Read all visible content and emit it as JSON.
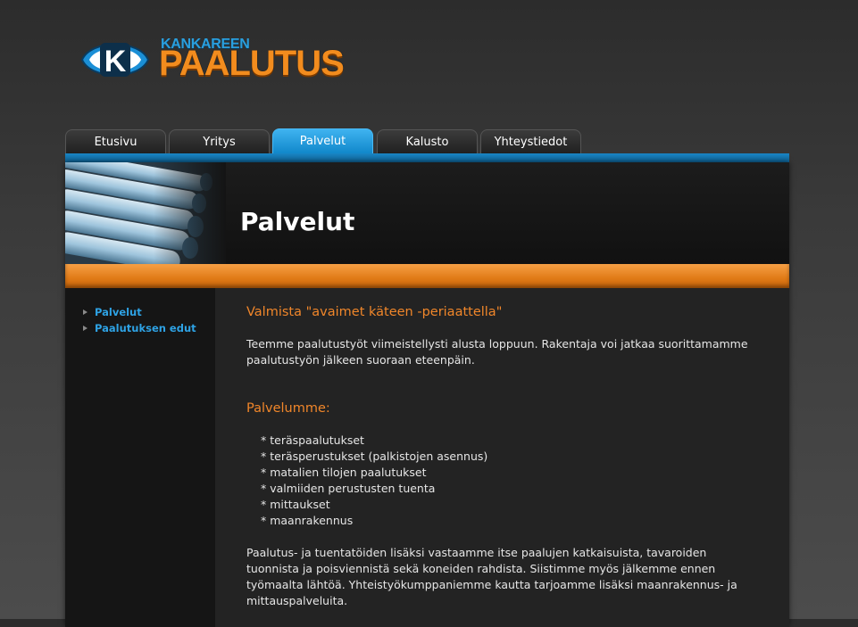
{
  "brand": {
    "badge_letter": "K",
    "name_top": "KANKAREEN",
    "name_main": "PAALUTUS",
    "colors": {
      "blue": "#2a9fde",
      "orange": "#f28c1e"
    }
  },
  "nav": {
    "tabs": [
      {
        "label": "Etusivu",
        "active": false
      },
      {
        "label": "Yritys",
        "active": false
      },
      {
        "label": "Palvelut",
        "active": true
      },
      {
        "label": "Kalusto",
        "active": false
      },
      {
        "label": "Yhteystiedot",
        "active": false
      }
    ]
  },
  "banner": {
    "title": "Palvelut"
  },
  "sidebar": {
    "items": [
      {
        "label": "Palvelut",
        "icon": "arrow-right-icon"
      },
      {
        "label": "Paalutuksen edut",
        "icon": "arrow-right-icon"
      }
    ]
  },
  "content": {
    "heading": "Valmista \"avaimet käteen -periaattella\"",
    "intro": "Teemme paalutustyöt viimeistellysti alusta loppuun. Rakentaja voi jatkaa suorittamamme paalutustyön jälkeen suoraan eteenpäin.",
    "services_heading": "Palvelumme:",
    "services": [
      "* teräspaalutukset",
      "* teräsperustukset (palkistojen asennus)",
      "* matalien tilojen paalutukset",
      "* valmiiden perustusten tuenta",
      "* mittaukset",
      "* maanrakennus"
    ],
    "closing": "Paalutus- ja tuentatöiden lisäksi vastaamme itse paalujen katkaisuista, tavaroiden tuonnista ja poisviennistä sekä koneiden rahdista. Siistimme myös jälkemme ennen työmaalta lähtöä. Yhteistyökumppaniemme kautta tarjoamme lisäksi maanrakennus- ja mittauspalveluita."
  }
}
